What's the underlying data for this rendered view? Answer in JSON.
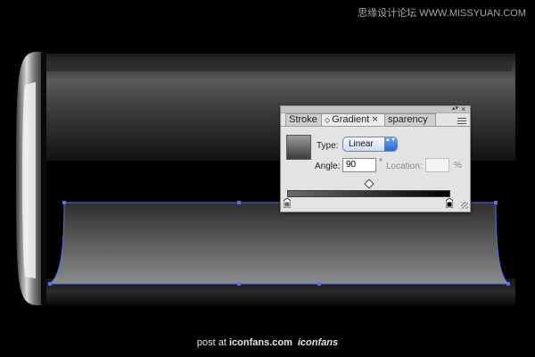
{
  "watermark": "思缘设计论坛 WWW.MISSYUAN.COM",
  "credit": {
    "prefix": "post at ",
    "brand": "iconfans.com",
    "logo": "iconfans"
  },
  "gradient_panel": {
    "tabs": [
      {
        "label": "Stroke"
      },
      {
        "label": "Gradient",
        "close_glyph": "×",
        "diamond_glyph": "◇"
      },
      {
        "label": "sparency"
      }
    ],
    "close_glyph": "×",
    "collapse_glyph": "▴▾",
    "type_label": "Type:",
    "type_value": "Linear",
    "type_options_glyph": "▲▼",
    "angle_label": "Angle:",
    "angle_value": "90",
    "degree_symbol": "°",
    "location_label": "Location:",
    "location_value": "",
    "percent_symbol": "%",
    "gradient": {
      "start_color": "#6a6a6a",
      "end_color": "#000000",
      "midpoint_percent": 50
    }
  },
  "colors": {
    "background": "#000000",
    "selection_path": "#5a6ee6",
    "battery_body_light": "#585858",
    "battery_body_dark": "#0e0e0e"
  }
}
